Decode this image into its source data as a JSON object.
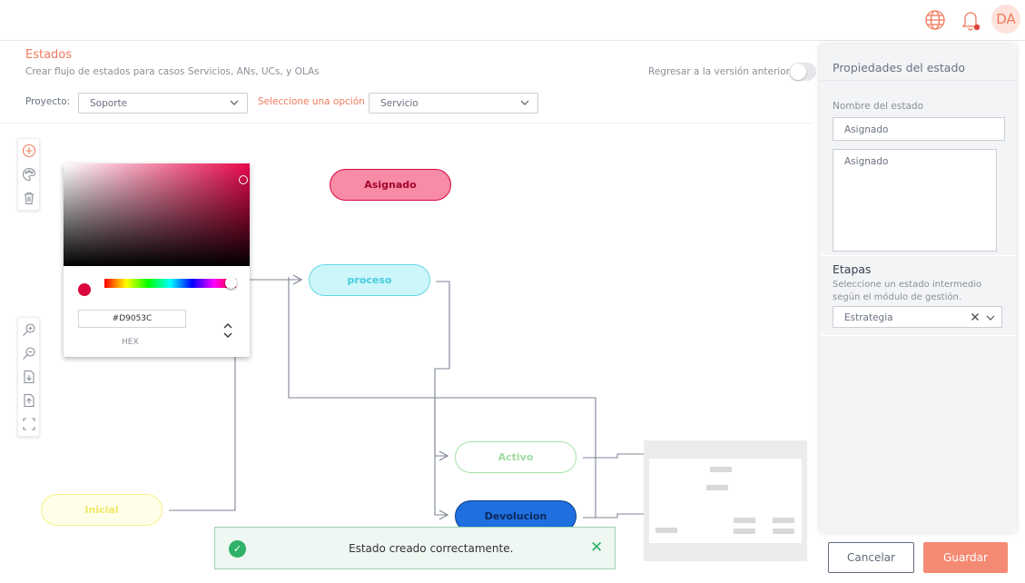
{
  "topbar": {
    "icons": [
      "globe-icon",
      "bell-icon"
    ],
    "avatar_initials": "DA"
  },
  "header": {
    "title": "Estados",
    "subtitle": "Crear flujo de estados para casos Servicios, ANs, UCs, y OLAs",
    "revert_label": "Regresar a la versión anterior"
  },
  "filters": {
    "project_label": "Proyecto:",
    "project_value": "Soporte",
    "option_label": "Seleccione una opción",
    "option_value": "Servicio"
  },
  "toolbar_top": [
    "add-icon",
    "palette-icon",
    "trash-icon"
  ],
  "toolbar_bottom": [
    "zoom-in-icon",
    "zoom-out-icon",
    "import-icon",
    "export-icon",
    "fit-screen-icon"
  ],
  "color_picker": {
    "hex_value": "#D9053C",
    "mode_label": "HEX",
    "selected_color": "#D9053C"
  },
  "nodes": [
    {
      "label": "Asignado"
    },
    {
      "label": "proceso"
    },
    {
      "label": "Activo"
    },
    {
      "label": "Devolucion"
    },
    {
      "label": "Inicial"
    }
  ],
  "toast": {
    "message": "Estado creado correctamente."
  },
  "panel": {
    "title": "Propiedades del estado",
    "name_label": "Nombre del estado",
    "name_value": "Asignado",
    "description_value": "Asignado",
    "stages_title": "Etapas",
    "stages_help": "Seleccione un estado intermedio según el módulo de gestión.",
    "stage_value": "Estrategia"
  },
  "actions": {
    "cancel_label": "Cancelar",
    "save_label": "Guardar"
  },
  "colors": {
    "accent": "#f07a5c",
    "success": "#2fb167"
  }
}
